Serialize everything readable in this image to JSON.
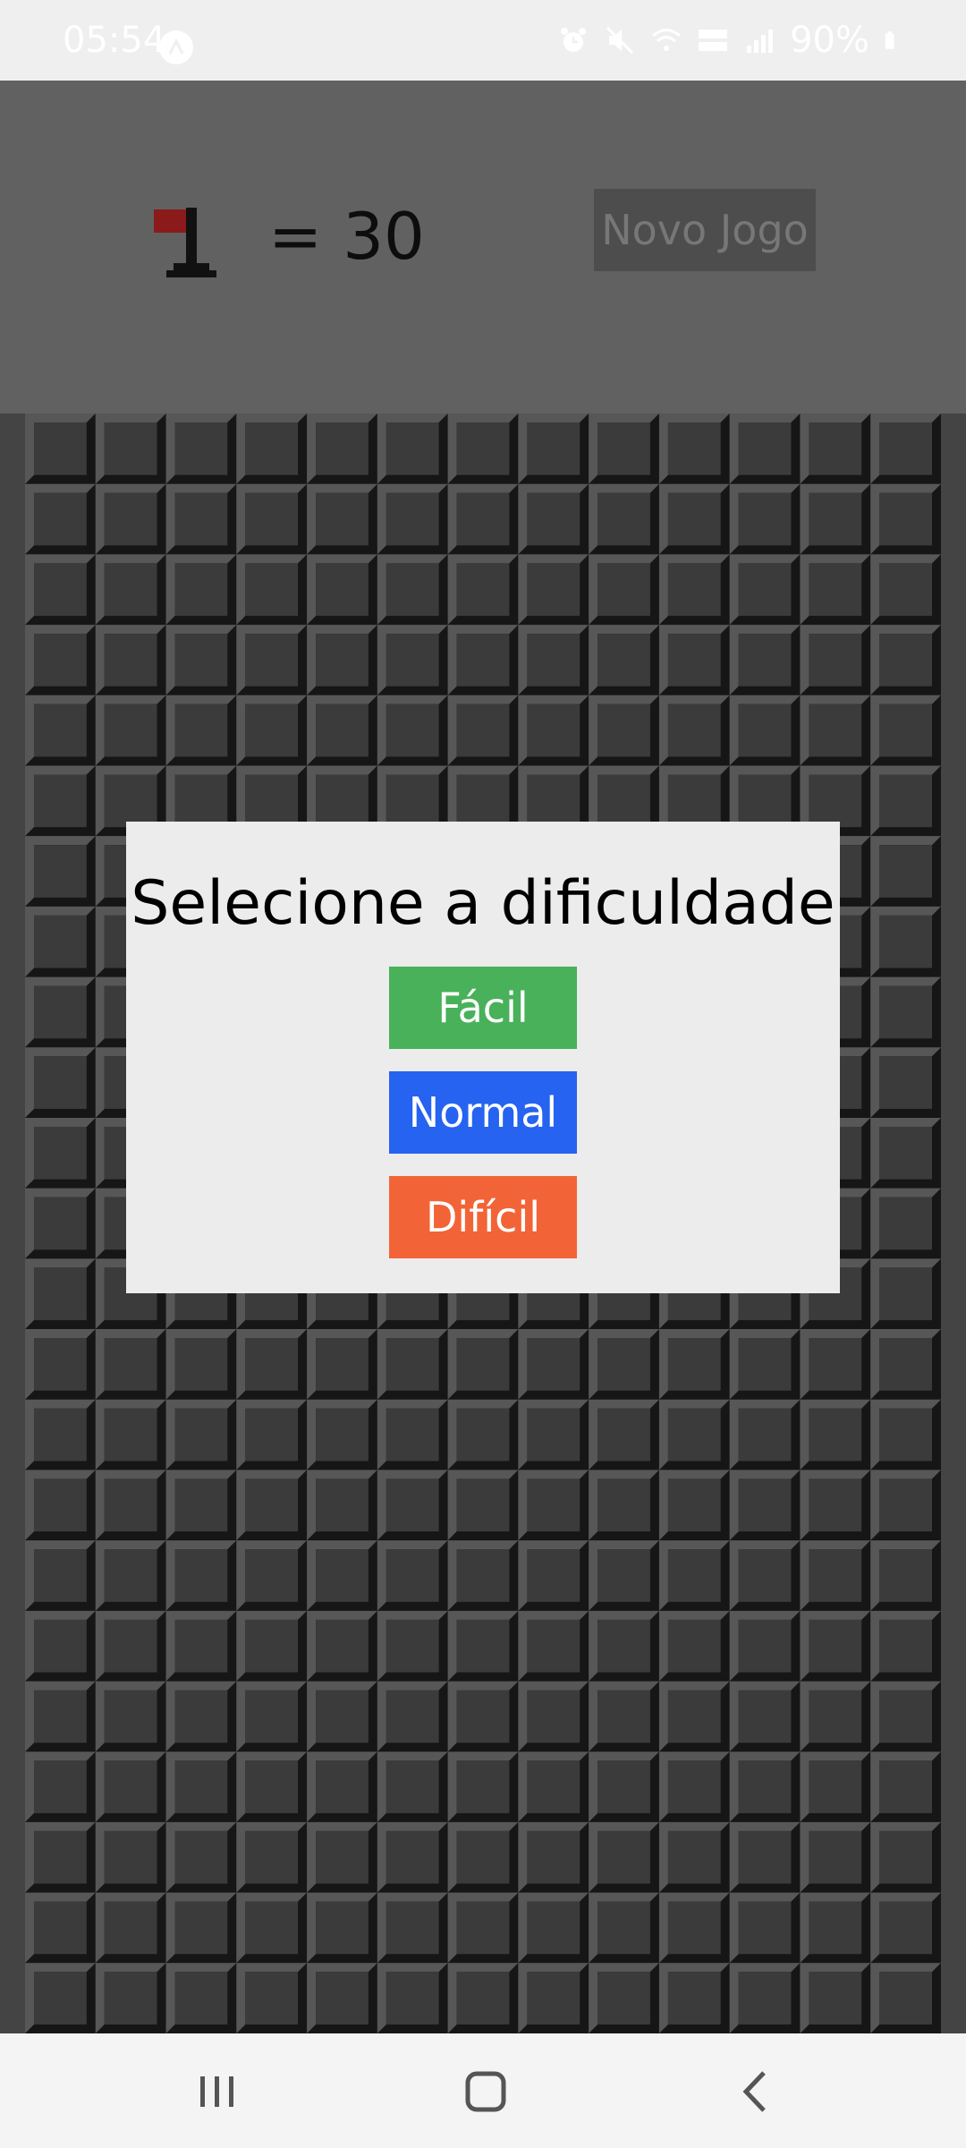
{
  "status_bar": {
    "time": "05:54",
    "battery": "90%",
    "icons": [
      "app-notification-icon",
      "alarm-icon",
      "mute-icon",
      "wifi-icon",
      "volte-lte2-icon",
      "signal-icon",
      "battery-icon"
    ]
  },
  "header": {
    "flag_count": "= 30",
    "new_game_label": "Novo Jogo",
    "flag_icon": "flag-icon"
  },
  "board": {
    "columns": 13,
    "rows": 23
  },
  "modal": {
    "title": "Selecione a dificuldade",
    "buttons": [
      {
        "label": "Fácil",
        "color": "#48b15a"
      },
      {
        "label": "Normal",
        "color": "#2563f0"
      },
      {
        "label": "Difícil",
        "color": "#f26437"
      }
    ]
  },
  "nav_bar": {
    "icons": [
      "recent-apps-icon",
      "home-icon",
      "back-icon"
    ]
  },
  "colors": {
    "topbar": "#616161",
    "board": "#3d3d3d",
    "modal_bg": "#ececec",
    "new_game_bg": "#4d4d4d"
  }
}
